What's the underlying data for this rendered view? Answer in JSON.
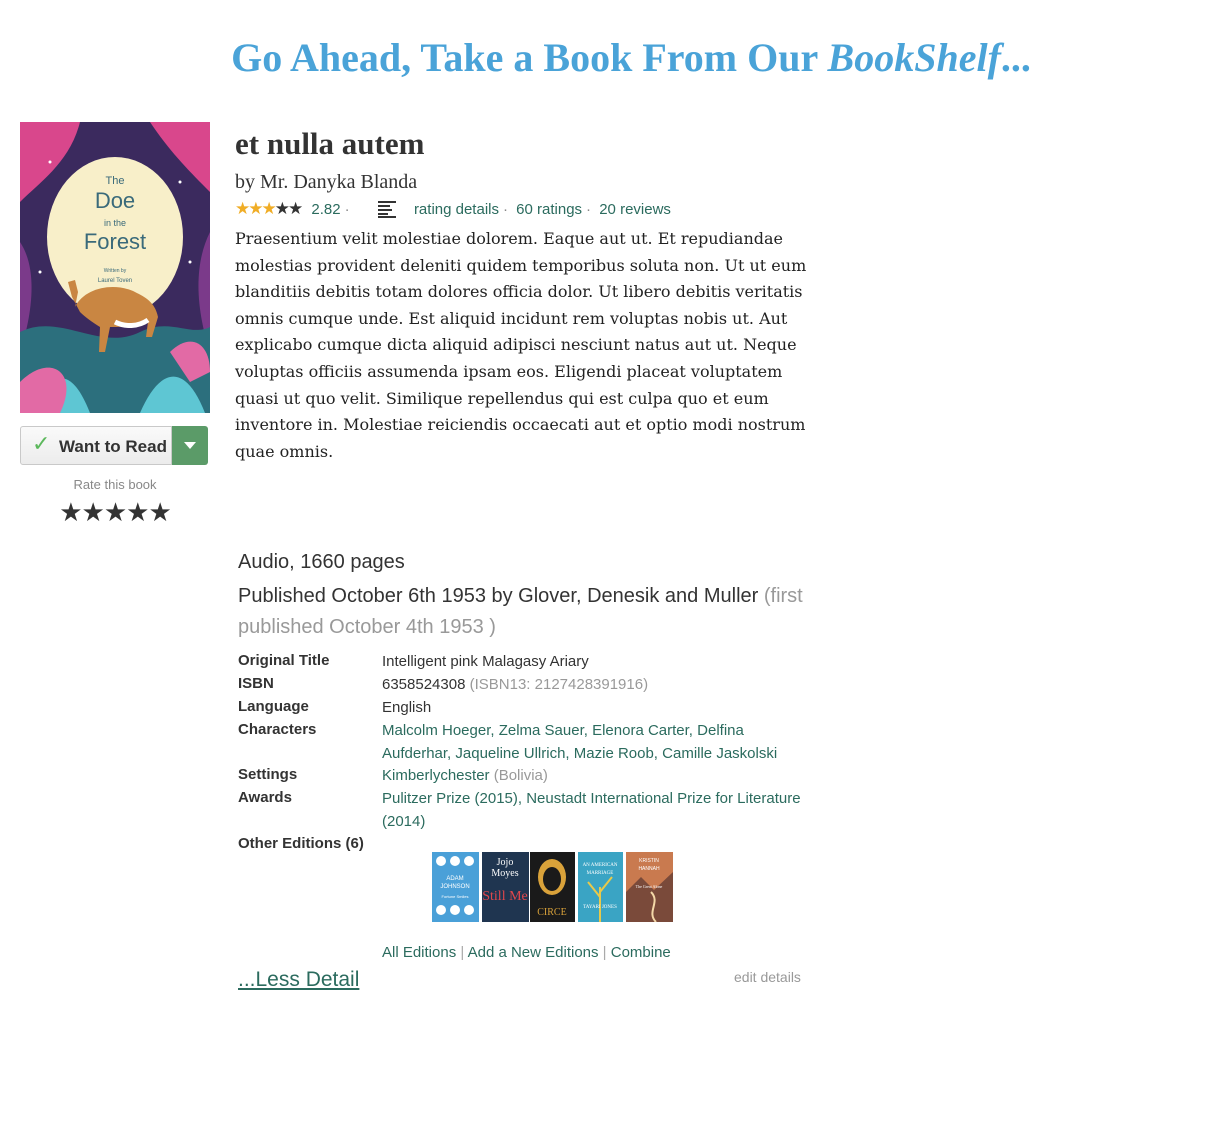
{
  "header": {
    "prefix": "Go Ahead, Take a Book From Our ",
    "brand": "BookShelf",
    "suffix": "..."
  },
  "cover": {
    "title_line1": "The",
    "title_line2": "Doe",
    "title_line3": "in the",
    "title_line4": "Forest",
    "written_by": "Written by",
    "author": "Laurel Toven"
  },
  "shelf": {
    "want_label": "Want to Read",
    "rate_label": "Rate this book",
    "rate_stars": "★★★★★"
  },
  "book": {
    "title": "et nulla autem",
    "author": "by Mr. Danyka Blanda",
    "rating_value": "2.82",
    "rating_stars": 3,
    "rating_details": "rating details",
    "ratings_count": "60 ratings",
    "reviews_count": "20 reviews",
    "description": "Praesentium velit molestiae dolorem. Eaque aut ut. Et repudiandae molestias provident deleniti quidem temporibus soluta non. Ut ut eum blanditiis debitis totam dolores officia dolor. Ut libero debitis veritatis omnis cumque unde. Est aliquid incidunt rem voluptas nobis ut. Aut explicabo cumque dicta aliquid adipisci nesciunt natus aut ut. Neque voluptas officiis assumenda ipsam eos. Eligendi placeat voluptatem quasi ut quo velit. Similique repellendus qui est culpa quo et eum inventore in. Molestiae reiciendis occaecati aut et optio modi nostrum quae omnis."
  },
  "details": {
    "format": "Audio, 1660 pages",
    "published": "Published October 6th 1953 by Glover, Denesik and Muller",
    "first_published": "(first published October 4th 1953 )",
    "original_title_label": "Original Title",
    "original_title": "Intelligent pink Malagasy Ariary",
    "isbn_label": "ISBN",
    "isbn": "6358524308",
    "isbn13": "(ISBN13: 2127428391916)",
    "language_label": "Language",
    "language": "English",
    "characters_label": "Characters",
    "characters": "Malcolm Hoeger, Zelma Sauer, Elenora Carter, Delfina Aufderhar, Jaqueline Ullrich, Mazie Roob, Camille Jaskolski",
    "settings_label": "Settings",
    "settings": "Kimberlychester",
    "settings_country": "(Bolivia)",
    "awards_label": "Awards",
    "awards": "Pulitzer Prize (2015), Neustadt International Prize for Literature (2014)",
    "other_editions_label": "Other Editions (6)"
  },
  "editions": [
    {
      "text1": "ADAM",
      "text2": "JOHNSON",
      "text3": "Fortune Smiles",
      "bg": "#4aa0d8"
    },
    {
      "text1": "Jojo",
      "text2": "Moyes",
      "text3": "Still Me",
      "bg": "#1f3550"
    },
    {
      "text1": "CIRCE",
      "text2": "",
      "text3": "",
      "bg": "#1a1a1a"
    },
    {
      "text1": "AN AMERICAN",
      "text2": "MARRIAGE",
      "text3": "TAYARI JONES",
      "bg": "#3aa4c4"
    },
    {
      "text1": "KRISTIN",
      "text2": "HANNAH",
      "text3": "The Great Alone",
      "bg": "#c97a4f"
    }
  ],
  "footer": {
    "all_editions": "All Editions",
    "add_edition": "Add a New Editions",
    "combine": "Combine",
    "less_detail": "...Less Detail",
    "edit_details": "edit details"
  },
  "colors": {
    "brand_blue": "#4aa3d8",
    "link_green": "#2b6b5e",
    "star_gold": "#f0ad26",
    "button_green": "#5b9b68"
  }
}
